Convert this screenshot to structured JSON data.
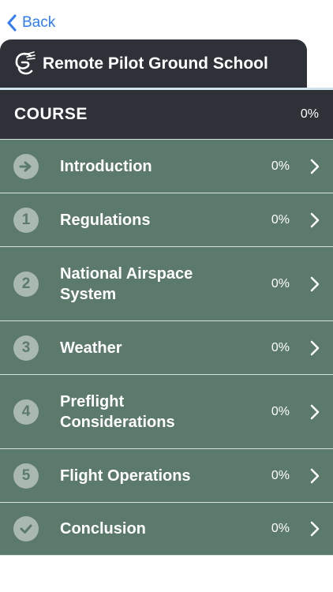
{
  "nav": {
    "back_label": "Back"
  },
  "header": {
    "title": "Remote Pilot Ground School"
  },
  "course": {
    "label": "COURSE",
    "progress": "0%"
  },
  "lessons": [
    {
      "badge": "",
      "icon": "arrow-right-icon",
      "title": "Introduction",
      "progress": "0%"
    },
    {
      "badge": "1",
      "title": "Regulations",
      "progress": "0%"
    },
    {
      "badge": "2",
      "title": "National Airspace System",
      "progress": "0%"
    },
    {
      "badge": "3",
      "title": "Weather",
      "progress": "0%"
    },
    {
      "badge": "4",
      "title": "Preflight Considerations",
      "progress": "0%"
    },
    {
      "badge": "5",
      "title": "Flight Operations",
      "progress": "0%"
    },
    {
      "badge": "",
      "icon": "checkmark-icon",
      "title": "Conclusion",
      "progress": "0%"
    }
  ],
  "colors": {
    "accent_blue": "#2f7cf6",
    "header_dark": "#2e3138",
    "row_green": "#5c7a6c",
    "badge_gray": "#a9b8b0"
  }
}
